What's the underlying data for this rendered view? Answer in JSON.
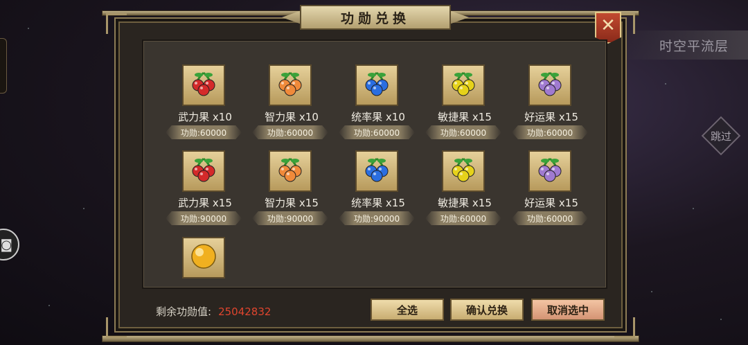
{
  "dialog": {
    "title": "功勋兑换",
    "close_icon": "✕"
  },
  "side": {
    "banner": "时空平流层",
    "skip": "跳过"
  },
  "items": [
    {
      "name": "武力果 x10",
      "cost": "功勋:60000",
      "color": "#d42a2a",
      "icon": "red-fruit-icon"
    },
    {
      "name": "智力果 x10",
      "cost": "功勋:60000",
      "color": "#f08a3a",
      "icon": "orange-fruit-icon"
    },
    {
      "name": "统率果 x10",
      "cost": "功勋:60000",
      "color": "#2a6ee0",
      "icon": "blue-fruit-icon"
    },
    {
      "name": "敏捷果 x15",
      "cost": "功勋:60000",
      "color": "#e6d21a",
      "icon": "yellow-fruit-icon"
    },
    {
      "name": "好运果 x15",
      "cost": "功勋:60000",
      "color": "#a07ad0",
      "icon": "purple-fruit-icon"
    },
    {
      "name": "武力果 x15",
      "cost": "功勋:90000",
      "color": "#d42a2a",
      "icon": "red-fruit-icon"
    },
    {
      "name": "智力果 x15",
      "cost": "功勋:90000",
      "color": "#f08a3a",
      "icon": "orange-fruit-icon"
    },
    {
      "name": "统率果 x15",
      "cost": "功勋:90000",
      "color": "#2a6ee0",
      "icon": "blue-fruit-icon"
    },
    {
      "name": "敏捷果 x15",
      "cost": "功勋:60000",
      "color": "#e6d21a",
      "icon": "yellow-fruit-icon"
    },
    {
      "name": "好运果 x15",
      "cost": "功勋:60000",
      "color": "#a07ad0",
      "icon": "purple-fruit-icon"
    },
    {
      "name": "",
      "cost": "",
      "color": "#f0b020",
      "icon": "golden-orb-icon"
    }
  ],
  "footer": {
    "remaining_label": "剩余功勋值:",
    "remaining_value": "25042832",
    "select_all": "全选",
    "confirm": "确认兑换",
    "cancel": "取消选中"
  }
}
